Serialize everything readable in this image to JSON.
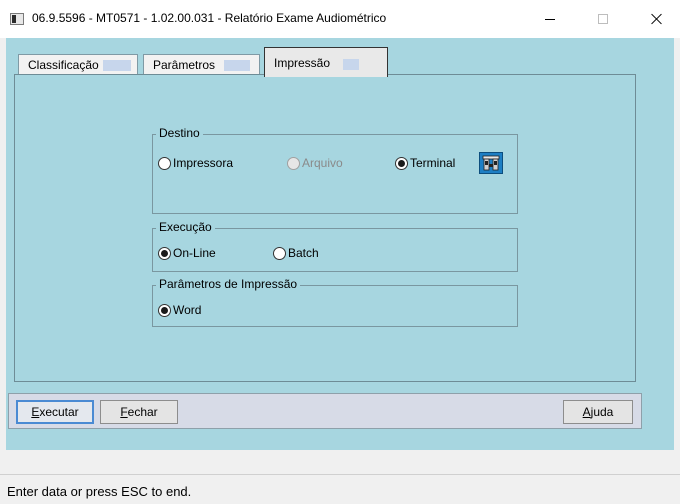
{
  "window": {
    "title": "06.9.5596 - MT0571 - 1.02.00.031 - Relatório Exame Audiométrico",
    "icon": "app-window-icon",
    "controls": [
      "minimize-icon",
      "maximize-icon",
      "close-icon"
    ]
  },
  "tabs": [
    {
      "label": "Classificação",
      "active": false
    },
    {
      "label": "Parâmetros",
      "active": false
    },
    {
      "label": "Impressão",
      "active": true
    }
  ],
  "destino": {
    "title": "Destino",
    "options": [
      {
        "label": "Impressora",
        "checked": false,
        "enabled": true
      },
      {
        "label": "Arquivo",
        "checked": false,
        "enabled": false
      },
      {
        "label": "Terminal",
        "checked": true,
        "enabled": true
      }
    ],
    "config_icon": "printer-settings-icon"
  },
  "execucao": {
    "title": "Execução",
    "options": [
      {
        "label": "On-Line",
        "checked": true
      },
      {
        "label": "Batch",
        "checked": false
      }
    ]
  },
  "parametros_impressao": {
    "title": "Parâmetros de Impressão",
    "options": [
      {
        "label": "Word",
        "checked": true
      }
    ]
  },
  "buttons": {
    "executar": {
      "underline": "E",
      "rest": "xecutar"
    },
    "fechar": {
      "underline": "F",
      "rest": "echar"
    },
    "ajuda": {
      "underline": "A",
      "rest": "juda"
    }
  },
  "status": "Enter data or press ESC to end.",
  "colors": {
    "client_background": "#a7d6e0",
    "button_bar": "#d7dbe7",
    "default_button_border": "#4a8ad3"
  }
}
